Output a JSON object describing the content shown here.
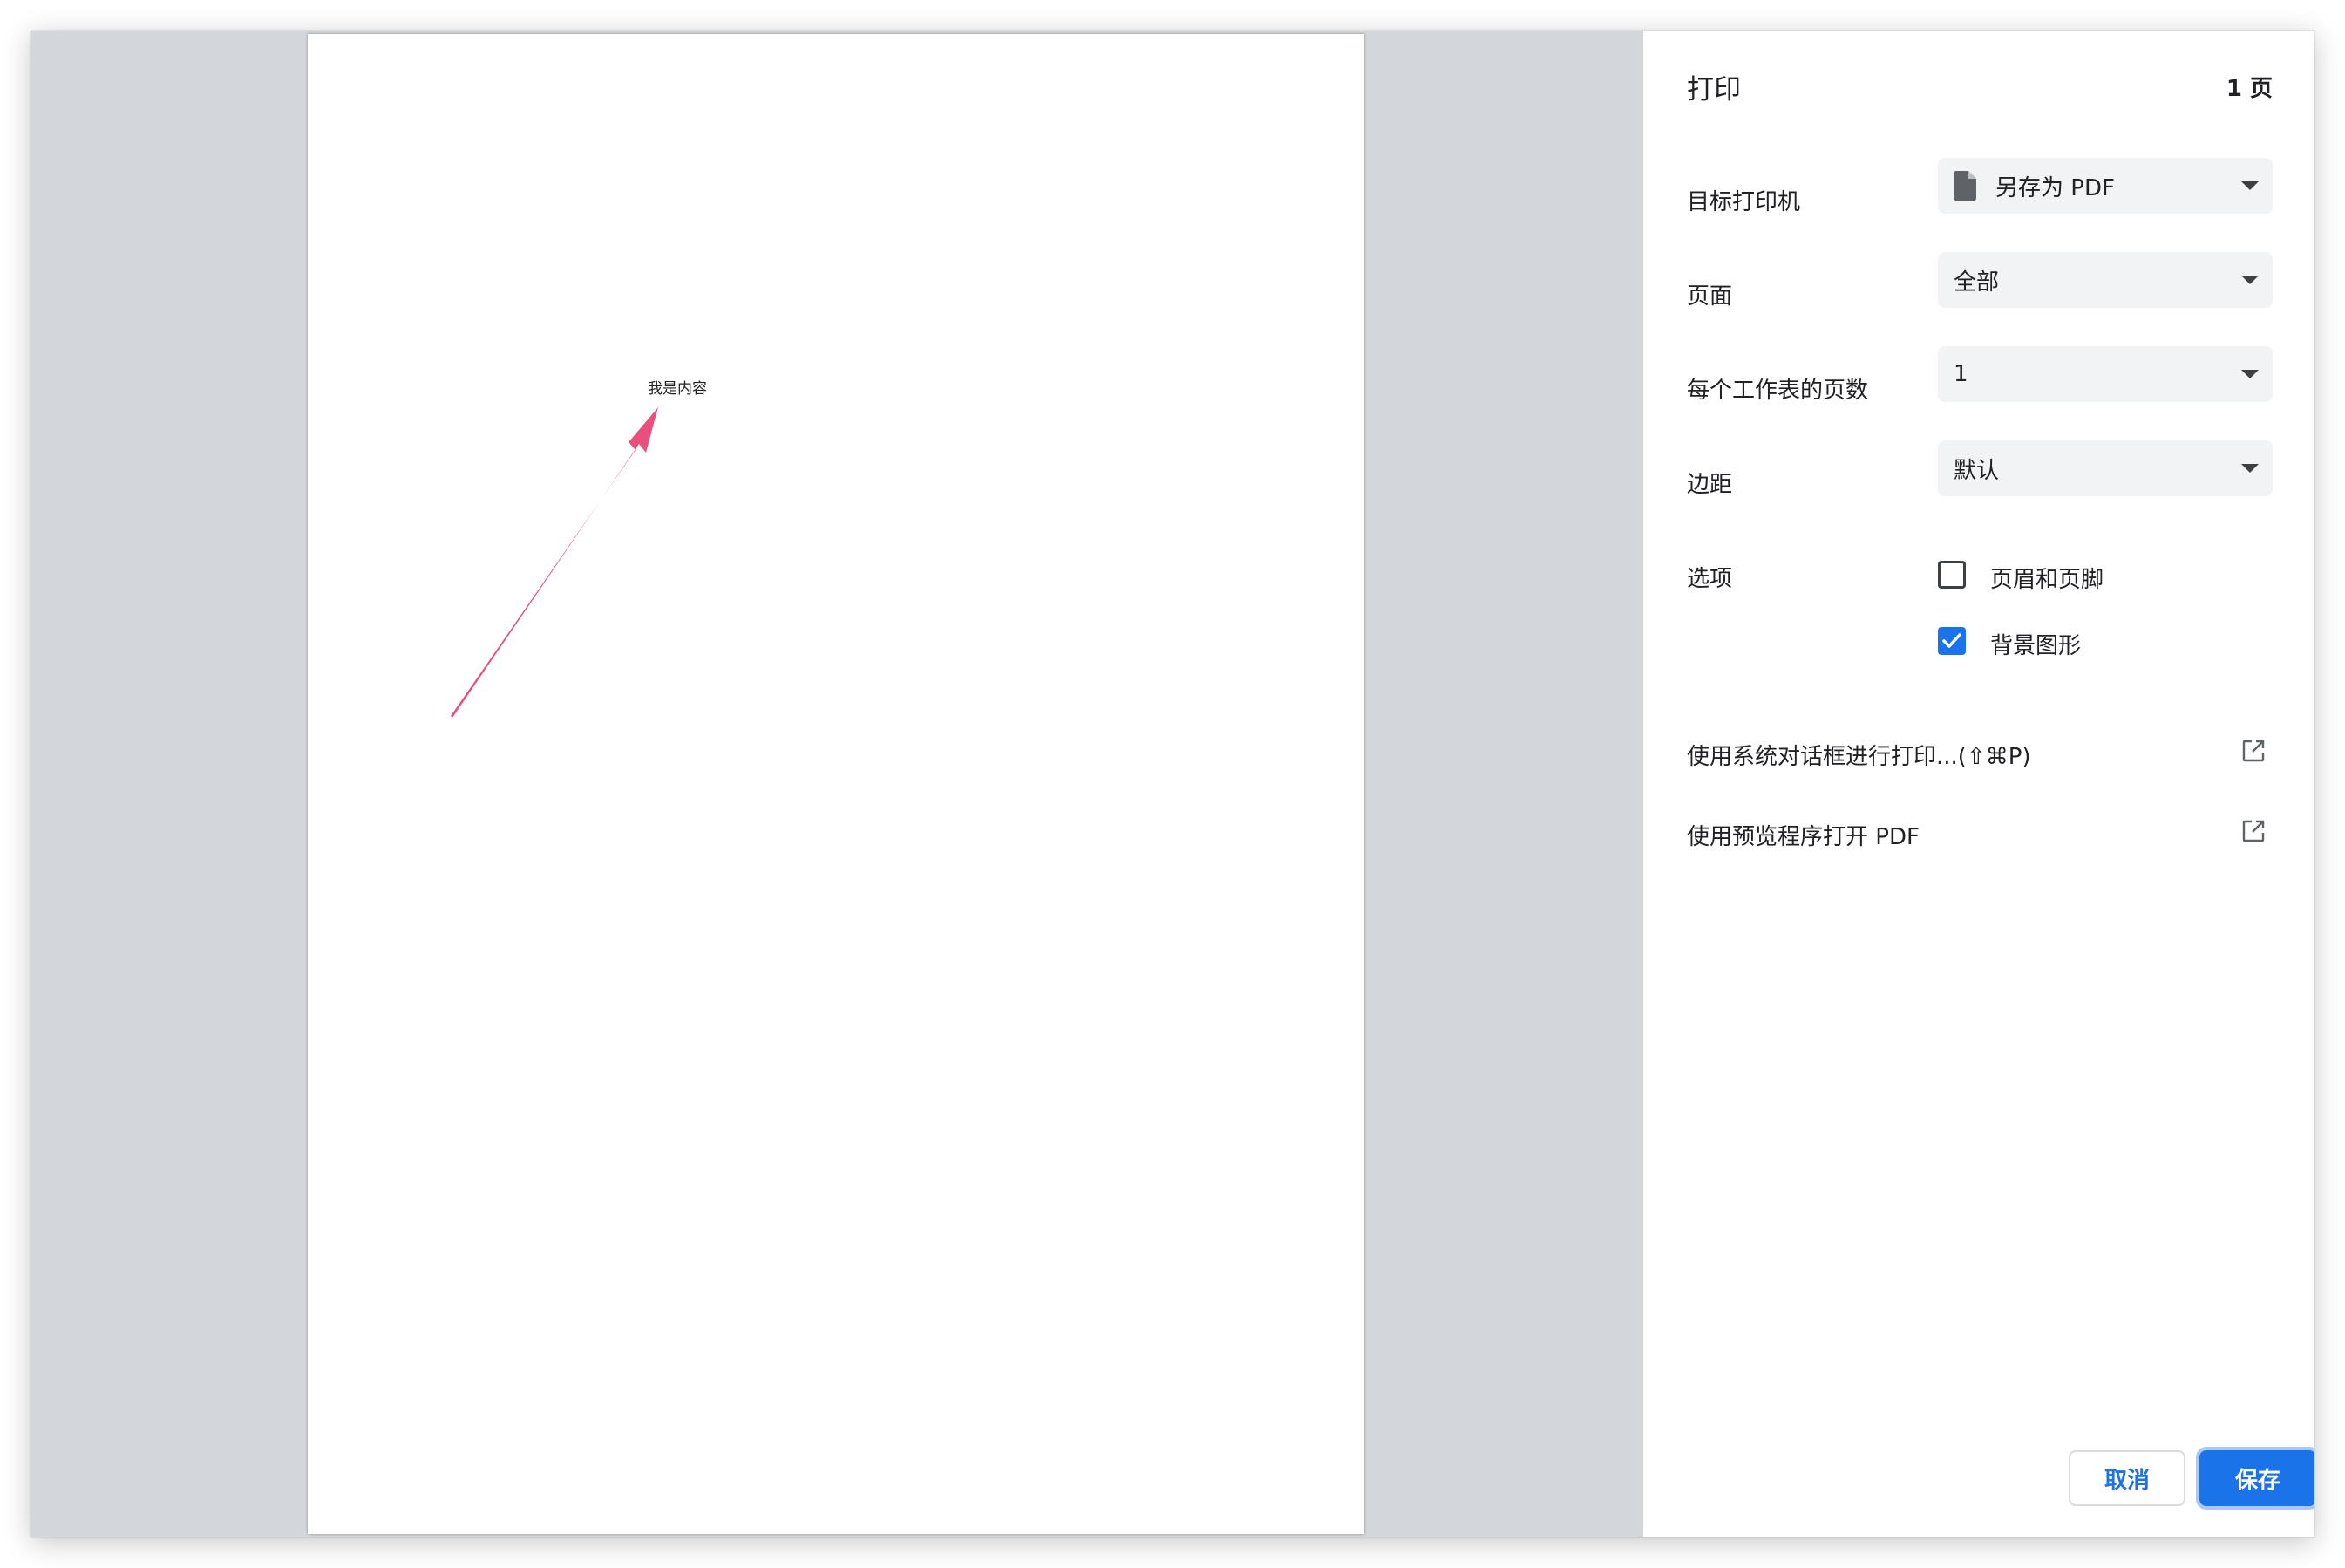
{
  "preview": {
    "page_text": "我是内容"
  },
  "panel": {
    "title": "打印",
    "page_count": "1 页",
    "destination": {
      "label": "目标打印机",
      "value": "另存为 PDF"
    },
    "pages": {
      "label": "页面",
      "value": "全部"
    },
    "pages_per_sheet": {
      "label": "每个工作表的页数",
      "value": "1"
    },
    "margins": {
      "label": "边距",
      "value": "默认"
    },
    "options": {
      "label": "选项",
      "items": [
        {
          "label": "页眉和页脚",
          "checked": false
        },
        {
          "label": "背景图形",
          "checked": true
        }
      ]
    },
    "system_dialog_link": "使用系统对话框进行打印...(⇧⌘P)",
    "open_preview_link": "使用预览程序打开 PDF"
  },
  "buttons": {
    "cancel": "取消",
    "save": "保存"
  },
  "colors": {
    "accent": "#1a73e8",
    "arrow": "#e8517e",
    "preview_bg": "#d3d6da"
  }
}
